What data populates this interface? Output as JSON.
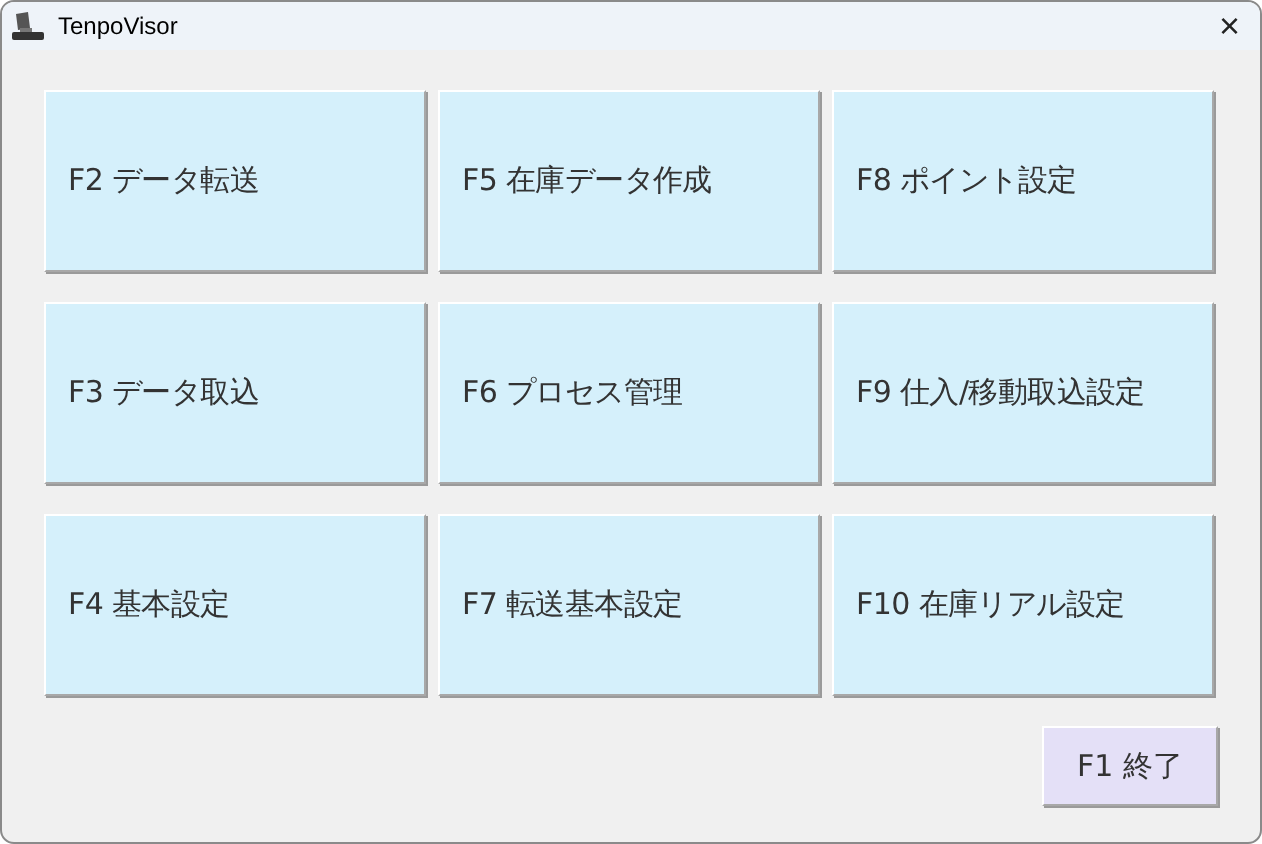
{
  "window": {
    "title": "TenpoVisor",
    "close": "×"
  },
  "menu_buttons": [
    {
      "label": "F2 データ転送"
    },
    {
      "label": "F5 在庫データ作成"
    },
    {
      "label": "F8 ポイント設定"
    },
    {
      "label": "F3 データ取込"
    },
    {
      "label": "F6 プロセス管理"
    },
    {
      "label": "F9 仕入/移動取込設定"
    },
    {
      "label": "F4 基本設定"
    },
    {
      "label": "F7 転送基本設定"
    },
    {
      "label": "F10 在庫リアル設定"
    }
  ],
  "exit_button": {
    "label": "F1 終了"
  }
}
